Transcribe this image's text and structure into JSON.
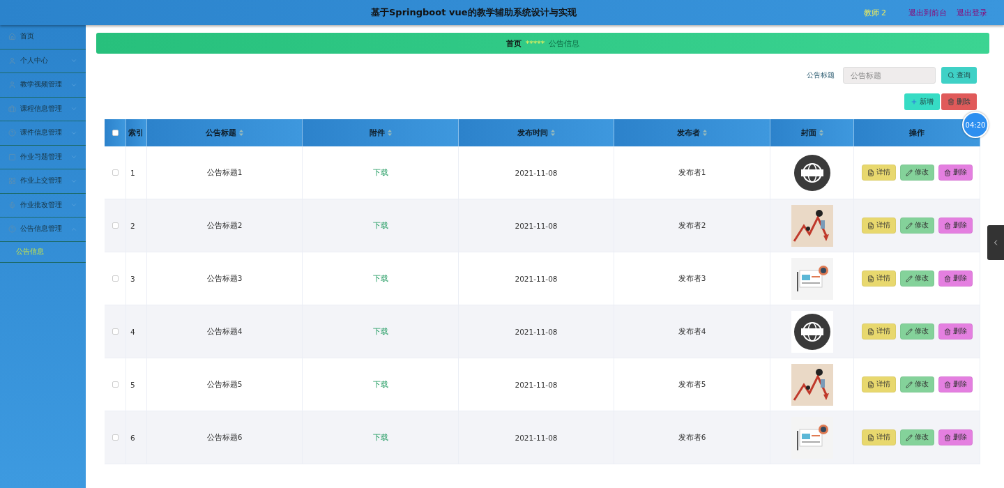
{
  "header": {
    "title": "基于Springboot vue的教学辅助系统设计与实现",
    "user": "教师 2",
    "links": [
      "退出到前台",
      "退出登录"
    ]
  },
  "sidebar": {
    "items": [
      {
        "label": "首页",
        "kind": "link"
      },
      {
        "label": "个人中心",
        "kind": "menu",
        "expanded": false
      },
      {
        "label": "教学视频管理",
        "kind": "menu",
        "expanded": false
      },
      {
        "label": "课程信息管理",
        "kind": "menu",
        "expanded": false
      },
      {
        "label": "课件信息管理",
        "kind": "menu",
        "expanded": false
      },
      {
        "label": "作业习题管理",
        "kind": "menu",
        "expanded": false
      },
      {
        "label": "作业上交管理",
        "kind": "menu",
        "expanded": false
      },
      {
        "label": "作业批改管理",
        "kind": "menu",
        "expanded": false
      },
      {
        "label": "公告信息管理",
        "kind": "menu",
        "expanded": true,
        "children": [
          {
            "label": "公告信息",
            "selected": true
          }
        ]
      }
    ]
  },
  "breadcrumb": {
    "home": "首页",
    "separator": "*****",
    "current": "公告信息"
  },
  "search": {
    "label": "公告标题",
    "placeholder": "公告标题",
    "button": "查询"
  },
  "actions": {
    "add": "新增",
    "delete": "删除"
  },
  "timer": "04:20",
  "table": {
    "header_checked": false,
    "columns": [
      "索引",
      "公告标题",
      "附件",
      "发布时间",
      "发布者",
      "封面",
      "操作"
    ],
    "rows": [
      {
        "checked": false,
        "index": "1",
        "title": "公告标题1",
        "attachment": "下载",
        "time": "2021-11-08",
        "publisher": "发布者1",
        "actions": [
          "详情",
          "修改",
          "删除"
        ]
      },
      {
        "checked": false,
        "index": "2",
        "title": "公告标题2",
        "attachment": "下载",
        "time": "2021-11-08",
        "publisher": "发布者2",
        "actions": [
          "详情",
          "修改",
          "删除"
        ]
      },
      {
        "checked": false,
        "index": "3",
        "title": "公告标题3",
        "attachment": "下载",
        "time": "2021-11-08",
        "publisher": "发布者3",
        "actions": [
          "详情",
          "修改",
          "删除"
        ]
      },
      {
        "checked": false,
        "index": "4",
        "title": "公告标题4",
        "attachment": "下载",
        "time": "2021-11-08",
        "publisher": "发布者4",
        "actions": [
          "详情",
          "修改",
          "删除"
        ]
      },
      {
        "checked": false,
        "index": "5",
        "title": "公告标题5",
        "attachment": "下载",
        "time": "2021-11-08",
        "publisher": "发布者5",
        "actions": [
          "详情",
          "修改",
          "删除"
        ]
      },
      {
        "checked": false,
        "index": "6",
        "title": "公告标题6",
        "attachment": "下载",
        "time": "2021-11-08",
        "publisher": "发布者6",
        "actions": [
          "详情",
          "修改",
          "删除"
        ]
      }
    ]
  }
}
